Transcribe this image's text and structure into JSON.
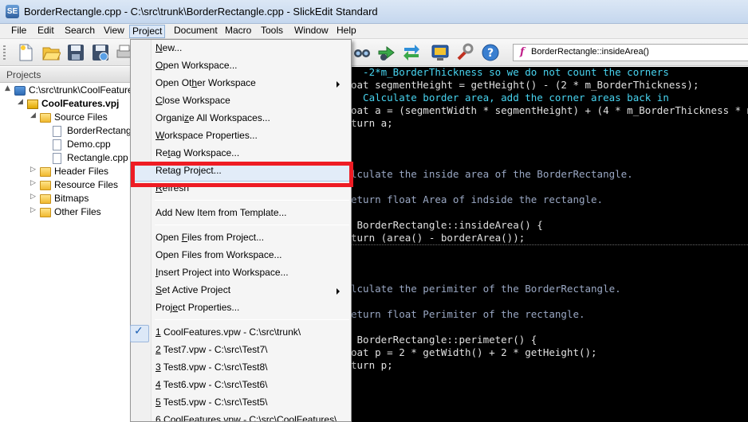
{
  "window": {
    "title": "BorderRectangle.cpp - C:\\src\\trunk\\BorderRectangle.cpp - SlickEdit Standard",
    "app_icon_label": "SE"
  },
  "menubar": {
    "items": [
      "File",
      "Edit",
      "Search",
      "View",
      "Project",
      "Document",
      "Macro",
      "Tools",
      "Window",
      "Help"
    ],
    "open_menu": "Project"
  },
  "toolbar": {
    "function_selector": "BorderRectangle::insideArea()",
    "function_icon": "f",
    "icons": [
      "new-file-icon",
      "open-folder-icon",
      "save-icon",
      "save-all-icon",
      "print-icon",
      "find-icon",
      "go-forward-icon",
      "replace-icon",
      "screen-icon",
      "tools-icon",
      "help-icon"
    ]
  },
  "projects_panel": {
    "title": "Projects",
    "tree": [
      {
        "label": "C:\\src\\trunk\\CoolFeatures.vpw",
        "icon": "workspace-icon",
        "expander": "▲"
      },
      {
        "label": "CoolFeatures.vpj",
        "icon": "project-icon",
        "expander": "◢",
        "bold": true
      },
      {
        "label": "Source Files",
        "icon": "folder-icon",
        "expander": "◢"
      },
      {
        "label": "BorderRectangle.cpp",
        "icon": "file-icon"
      },
      {
        "label": "Demo.cpp",
        "icon": "file-icon"
      },
      {
        "label": "Rectangle.cpp",
        "icon": "file-icon"
      },
      {
        "label": "Header Files",
        "icon": "folder-icon",
        "expander": "▷"
      },
      {
        "label": "Resource Files",
        "icon": "folder-icon",
        "expander": "▷"
      },
      {
        "label": "Bitmaps",
        "icon": "folder-icon",
        "expander": "▷"
      },
      {
        "label": "Other Files",
        "icon": "folder-icon",
        "expander": "▷"
      }
    ]
  },
  "project_menu": {
    "items": [
      {
        "label": "New...",
        "u": "N"
      },
      {
        "label": "Open Workspace...",
        "u": "O"
      },
      {
        "label": "Open Other Workspace",
        "u": "h",
        "submenu": true
      },
      {
        "label": "Close Workspace",
        "u": "C"
      },
      {
        "label": "Organize All Workspaces...",
        "u": "z"
      },
      {
        "label": "Workspace Properties...",
        "u": "W"
      },
      {
        "label": "Retag Workspace...",
        "u": "t"
      },
      {
        "label": "Retag Project...",
        "u": "g"
      },
      {
        "label": "Refresh",
        "u": "R"
      },
      {
        "label": "Add New Item from Template...",
        "u": ""
      },
      {
        "label": "Open Files from Project...",
        "u": "F"
      },
      {
        "label": "Open Files from Workspace...",
        "u": ""
      },
      {
        "label": "Insert Project into Workspace...",
        "u": "I"
      },
      {
        "label": "Set Active Project",
        "u": "S",
        "submenu": true
      },
      {
        "label": "Project Properties...",
        "u": "e"
      },
      {
        "label": "1 CoolFeatures.vpw - C:\\src\\trunk\\",
        "u": "1",
        "checked": true
      },
      {
        "label": "2 Test7.vpw - C:\\src\\Test7\\",
        "u": "2"
      },
      {
        "label": "3 Test8.vpw - C:\\src\\Test8\\",
        "u": "3"
      },
      {
        "label": "4 Test6.vpw - C:\\src\\Test6\\",
        "u": "4"
      },
      {
        "label": "5 Test5.vpw - C:\\src\\Test5\\",
        "u": "5"
      },
      {
        "label": "6 CoolFeatures.vpw - C:\\src\\CoolFeatures\\",
        "u": "6"
      }
    ],
    "highlighted": "Retag Project..."
  },
  "editor": {
    "lines": [
      {
        "text": "  -2*m_BorderThickness so we do not count the corners",
        "style": "cm"
      },
      {
        "text": "oat segmentHeight = getHeight() - (2 * m_BorderThickness);",
        "style": "code"
      },
      {
        "text": "  Calculate border area, add the corner areas back in",
        "style": "cm"
      },
      {
        "text": "oat a = (segmentWidth * segmentHeight) + (4 * m_BorderThickness * m_Bord",
        "style": "code"
      },
      {
        "text": "turn a;",
        "style": "code"
      },
      {
        "text": "",
        "style": "code"
      },
      {
        "text": "",
        "style": "code"
      },
      {
        "text": "",
        "style": "code"
      },
      {
        "text": "lculate the inside area of the BorderRectangle.",
        "style": "cm2"
      },
      {
        "text": "",
        "style": "code"
      },
      {
        "text": "eturn float Area of indside the rectangle.",
        "style": "cm2"
      },
      {
        "text": "",
        "style": "code"
      },
      {
        "text": " BorderRectangle::insideArea() {",
        "style": "code"
      },
      {
        "text": "turn (area() - borderArea());",
        "style": "code"
      },
      {
        "text": "",
        "style": "code"
      },
      {
        "text": "",
        "style": "code"
      },
      {
        "text": "",
        "style": "code"
      },
      {
        "text": "lculate the perimiter of the BorderRectangle.",
        "style": "cm2"
      },
      {
        "text": "",
        "style": "code"
      },
      {
        "text": "eturn float Perimiter of the rectangle.",
        "style": "cm2"
      },
      {
        "text": "",
        "style": "code"
      },
      {
        "text": " BorderRectangle::perimeter() {",
        "style": "code"
      },
      {
        "text": "oat p = 2 * getWidth() + 2 * getHeight();",
        "style": "code"
      },
      {
        "text": "turn p;",
        "style": "code"
      }
    ],
    "current_line": 13
  }
}
